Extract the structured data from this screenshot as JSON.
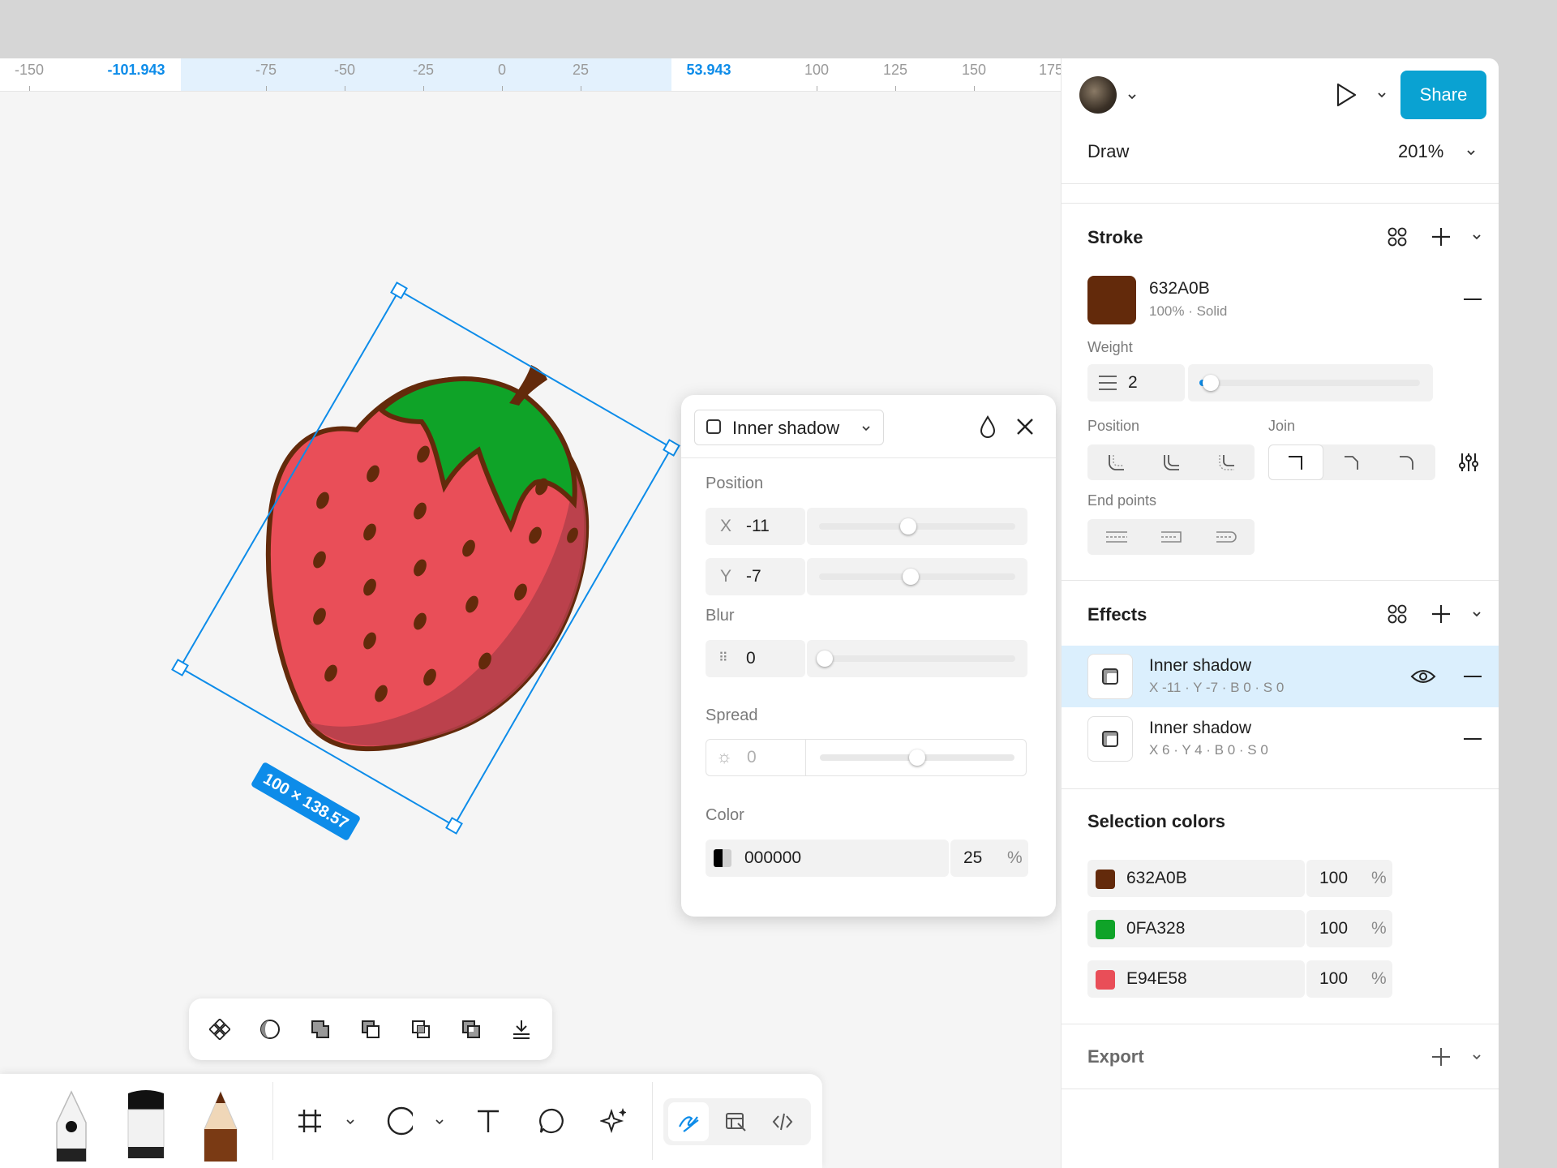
{
  "ruler": {
    "ticks": [
      "-150",
      "-101.943",
      "-75",
      "-50",
      "-25",
      "0",
      "25",
      "53.943",
      "100",
      "125",
      "150",
      "175"
    ]
  },
  "canvas": {
    "size_label": "100 × 138.57",
    "colors": {
      "stroke": "#632A0B",
      "leaf": "#0FA328",
      "fill": "#E94E58",
      "selection": "#0D8CE9"
    }
  },
  "header": {
    "play_icon": "play-icon",
    "share_label": "Share",
    "mode_label": "Draw",
    "zoom_label": "201%"
  },
  "stroke": {
    "title": "Stroke",
    "color_hex": "632A0B",
    "color_meta": "100% · Solid",
    "weight_label": "Weight",
    "weight_value": "2",
    "weight_level": 0.05,
    "position_label": "Position",
    "join_label": "Join",
    "endpoints_label": "End points"
  },
  "effects": {
    "title": "Effects",
    "items": [
      {
        "name": "Inner shadow",
        "detail": "X -11 · Y -7 · B 0 · S 0"
      },
      {
        "name": "Inner shadow",
        "detail": "X 6 · Y 4 · B 0 · S 0"
      }
    ]
  },
  "selection_colors": {
    "title": "Selection colors",
    "items": [
      {
        "hex": "632A0B",
        "opacity": "100",
        "unit": "%",
        "color": "#632A0B"
      },
      {
        "hex": "0FA328",
        "opacity": "100",
        "unit": "%",
        "color": "#0FA328"
      },
      {
        "hex": "E94E58",
        "opacity": "100",
        "unit": "%",
        "color": "#E94E58"
      }
    ]
  },
  "export": {
    "title": "Export"
  },
  "popup": {
    "type_label": "Inner shadow",
    "position_label": "Position",
    "x_label": "X",
    "x_value": "-11",
    "y_label": "Y",
    "y_value": "-7",
    "blur_label": "Blur",
    "blur_value": "0",
    "spread_label": "Spread",
    "spread_value": "0",
    "color_label": "Color",
    "color_hex": "000000",
    "color_opacity": "25",
    "opacity_unit": "%"
  }
}
